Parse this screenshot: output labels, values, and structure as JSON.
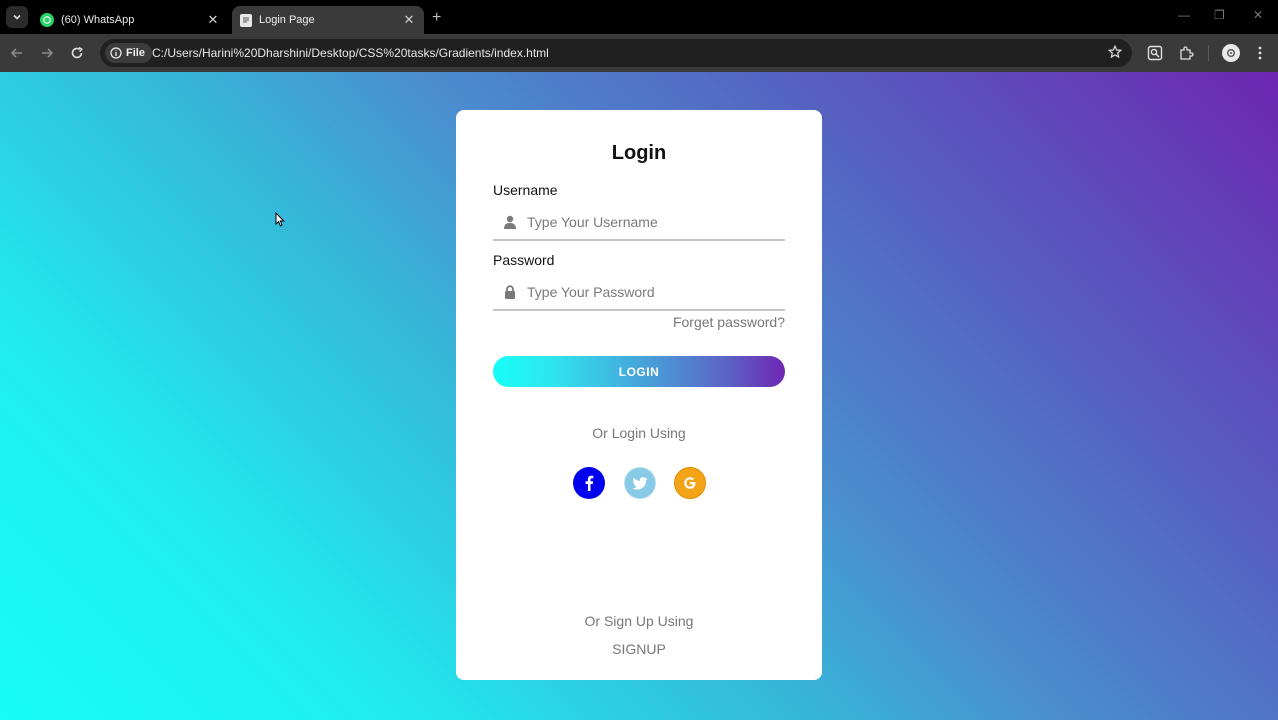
{
  "browser": {
    "tabs": [
      {
        "title": "(60) WhatsApp",
        "active": false
      },
      {
        "title": "Login Page",
        "active": true
      }
    ],
    "chip_label": "File",
    "url": "C:/Users/Harini%20Dharshini/Desktop/CSS%20tasks/Gradients/index.html"
  },
  "login": {
    "title": "Login",
    "username_label": "Username",
    "username_placeholder": "Type Your Username",
    "password_label": "Password",
    "password_placeholder": "Type Your Password",
    "forgot": "Forget password?",
    "button": "LOGIN",
    "or_login": "Or Login Using",
    "social": [
      {
        "name": "facebook",
        "icon": "facebook-icon",
        "color": "#0000ee"
      },
      {
        "name": "twitter",
        "icon": "twitter-icon",
        "color": "#88c9e6"
      },
      {
        "name": "google",
        "icon": "google-icon",
        "color": "#f3a416"
      }
    ],
    "or_signup": "Or Sign Up Using",
    "signup": "SIGNUP"
  },
  "colors": {
    "gradient_start": "#18fdf7",
    "gradient_end": "#6d26b3",
    "card": "#ffffff",
    "muted_text": "#777777"
  }
}
